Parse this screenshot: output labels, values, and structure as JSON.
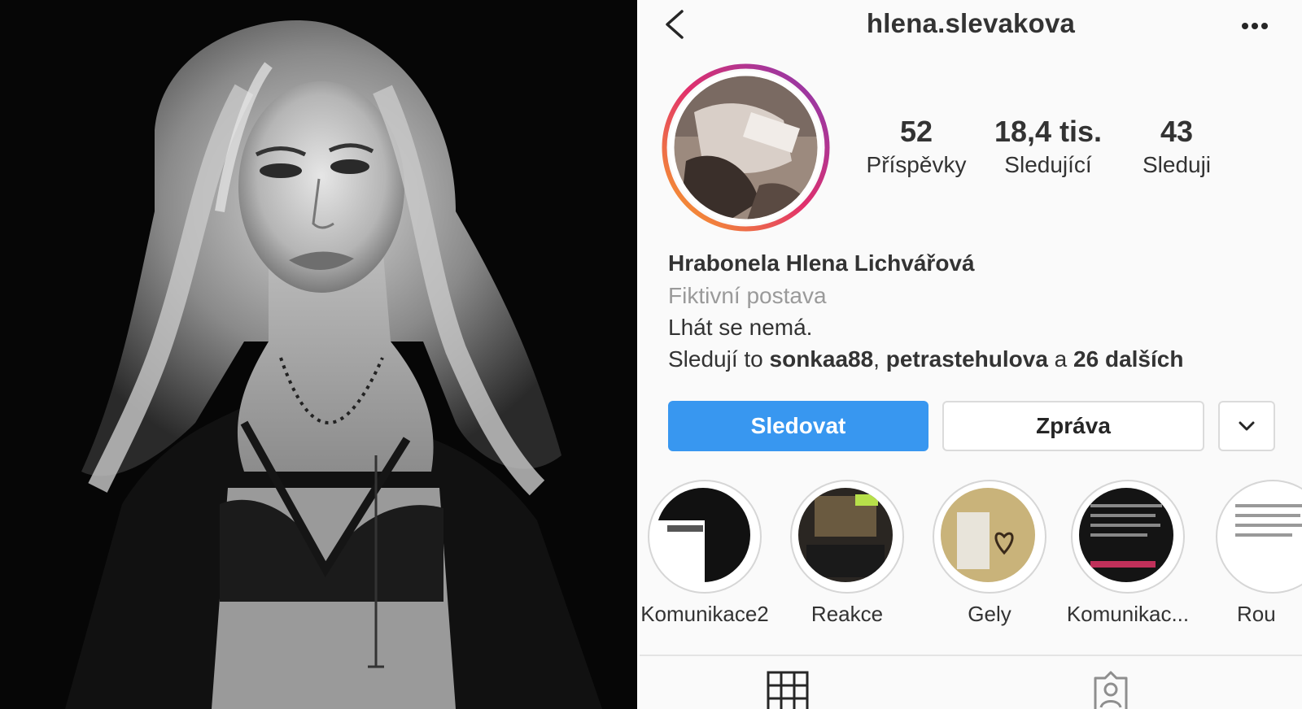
{
  "profile": {
    "username": "hlena.slevakova",
    "stats": [
      {
        "value": "52",
        "label": "Příspěvky"
      },
      {
        "value": "18,4 tis.",
        "label": "Sledující"
      },
      {
        "value": "43",
        "label": "Sleduji"
      }
    ],
    "name": "Hrabonela Hlena Lichvářová",
    "category": "Fiktivní postava",
    "bio": "Lhát se nemá.",
    "followed_by": {
      "prefix": "Sledují to ",
      "user1": "sonkaa88",
      "sep": ", ",
      "user2": "petrastehulova",
      "conj": " a ",
      "others": "26 dalších"
    }
  },
  "buttons": {
    "follow": "Sledovat",
    "message": "Zpráva"
  },
  "highlights": [
    {
      "label": "Komunikace2"
    },
    {
      "label": "Reakce"
    },
    {
      "label": "Gely"
    },
    {
      "label": "Komunikac..."
    },
    {
      "label": "Rou"
    }
  ],
  "icons": {
    "back": "chevron-left-icon",
    "more": "more-dots-icon",
    "expand": "chevron-down-icon",
    "grid_tab": "grid-icon",
    "tagged_tab": "tagged-person-icon"
  },
  "colors": {
    "follow_button": "#3897f0",
    "story_ring_start": "#f9a825",
    "story_ring_mid": "#e1306c",
    "story_ring_end": "#833ab4"
  }
}
